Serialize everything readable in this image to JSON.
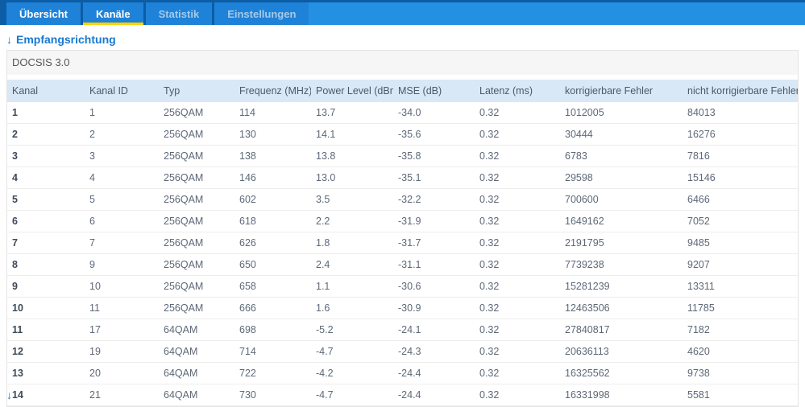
{
  "tabs": [
    {
      "label": "Übersicht",
      "active": false,
      "muted": false
    },
    {
      "label": "Kanäle",
      "active": true,
      "muted": false
    },
    {
      "label": "Statistik",
      "active": false,
      "muted": true
    },
    {
      "label": "Einstellungen",
      "active": false,
      "muted": true
    }
  ],
  "direction_link": {
    "arrow": "↓",
    "label": "Empfangsrichtung"
  },
  "section": {
    "title": "DOCSIS 3.0"
  },
  "table": {
    "columns": [
      "Kanal",
      "Kanal ID",
      "Typ",
      "Frequenz (MHz)",
      "Power Level (dBmV)",
      "MSE (dB)",
      "Latenz (ms)",
      "korrigierbare Fehler",
      "nicht korrigierbare Fehler"
    ],
    "rows": [
      [
        "1",
        "1",
        "256QAM",
        "114",
        "13.7",
        "-34.0",
        "0.32",
        "1012005",
        "84013"
      ],
      [
        "2",
        "2",
        "256QAM",
        "130",
        "14.1",
        "-35.6",
        "0.32",
        "30444",
        "16276"
      ],
      [
        "3",
        "3",
        "256QAM",
        "138",
        "13.8",
        "-35.8",
        "0.32",
        "6783",
        "7816"
      ],
      [
        "4",
        "4",
        "256QAM",
        "146",
        "13.0",
        "-35.1",
        "0.32",
        "29598",
        "15146"
      ],
      [
        "5",
        "5",
        "256QAM",
        "602",
        "3.5",
        "-32.2",
        "0.32",
        "700600",
        "6466"
      ],
      [
        "6",
        "6",
        "256QAM",
        "618",
        "2.2",
        "-31.9",
        "0.32",
        "1649162",
        "7052"
      ],
      [
        "7",
        "7",
        "256QAM",
        "626",
        "1.8",
        "-31.7",
        "0.32",
        "2191795",
        "9485"
      ],
      [
        "8",
        "9",
        "256QAM",
        "650",
        "2.4",
        "-31.1",
        "0.32",
        "7739238",
        "9207"
      ],
      [
        "9",
        "10",
        "256QAM",
        "658",
        "1.1",
        "-30.6",
        "0.32",
        "15281239",
        "13311"
      ],
      [
        "10",
        "11",
        "256QAM",
        "666",
        "1.6",
        "-30.9",
        "0.32",
        "12463506",
        "11785"
      ],
      [
        "11",
        "17",
        "64QAM",
        "698",
        "-5.2",
        "-24.1",
        "0.32",
        "27840817",
        "7182"
      ],
      [
        "12",
        "19",
        "64QAM",
        "714",
        "-4.7",
        "-24.3",
        "0.32",
        "20636113",
        "4620"
      ],
      [
        "13",
        "20",
        "64QAM",
        "722",
        "-4.2",
        "-24.4",
        "0.32",
        "16325562",
        "9738"
      ],
      [
        "14",
        "21",
        "64QAM",
        "730",
        "-4.7",
        "-24.4",
        "0.32",
        "16331998",
        "5581"
      ]
    ]
  },
  "bottom_link": {
    "arrow": "↓"
  },
  "colors": {
    "bar_background": "#2490e2",
    "bar_dark": "#0c5da5",
    "tab_background": "#1e82d8",
    "active_underline": "#ffd400",
    "link_blue": "#1779d0",
    "table_header_background": "#d9e8f6"
  }
}
